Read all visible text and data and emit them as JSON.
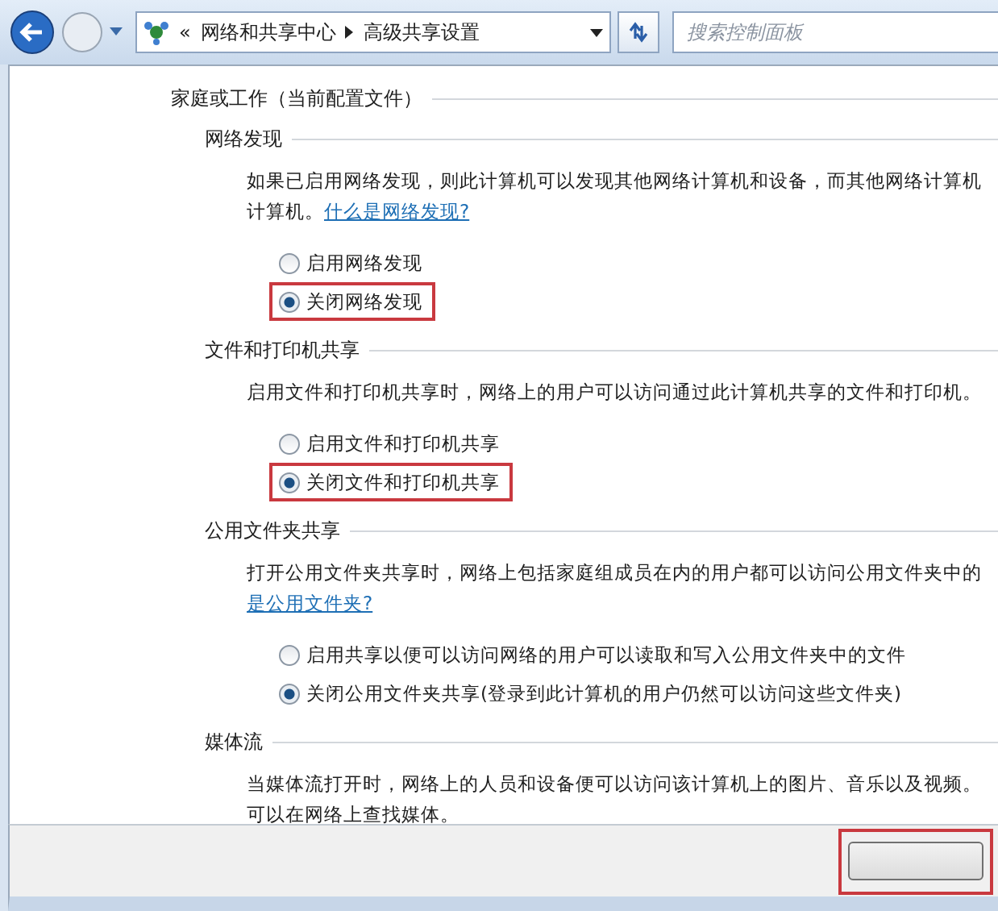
{
  "toolbar": {
    "breadcrumb_prefix": "«",
    "breadcrumbs": [
      "网络和共享中心",
      "高级共享设置"
    ],
    "search": {
      "placeholder": "搜索控制面板"
    }
  },
  "profile": {
    "title": "家庭或工作（当前配置文件）",
    "sections": [
      {
        "title": "网络发现",
        "lines": [
          "如果已启用网络发现，则此计算机可以发现其他网络计算机和设备，而其他网络计算机",
          "计算机。"
        ],
        "link": "什么是网络发现?",
        "options": [
          {
            "label": "启用网络发现",
            "selected": false,
            "highlighted": false
          },
          {
            "label": "关闭网络发现",
            "selected": true,
            "highlighted": true
          }
        ]
      },
      {
        "title": "文件和打印机共享",
        "lines": [
          "启用文件和打印机共享时，网络上的用户可以访问通过此计算机共享的文件和打印机。"
        ],
        "options": [
          {
            "label": "启用文件和打印机共享",
            "selected": false,
            "highlighted": false
          },
          {
            "label": "关闭文件和打印机共享",
            "selected": true,
            "highlighted": true
          }
        ]
      },
      {
        "title": "公用文件夹共享",
        "lines": [
          "打开公用文件夹共享时，网络上包括家庭组成员在内的用户都可以访问公用文件夹中的"
        ],
        "link_line": "是公用文件夹?",
        "options": [
          {
            "label": "启用共享以便可以访问网络的用户可以读取和写入公用文件夹中的文件",
            "selected": false,
            "highlighted": false
          },
          {
            "label": "关闭公用文件夹共享(登录到此计算机的用户仍然可以访问这些文件夹)",
            "selected": true,
            "highlighted": false
          }
        ]
      },
      {
        "title": "媒体流",
        "lines": [
          "当媒体流打开时，网络上的人员和设备便可以访问该计算机上的图片、音乐以及视频。",
          "可以在网络上查找媒体。"
        ]
      }
    ]
  },
  "footer": {
    "button_highlighted": true
  }
}
